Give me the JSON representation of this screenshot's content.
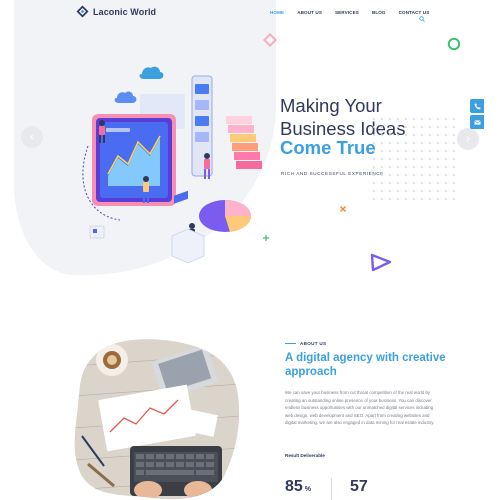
{
  "brand": {
    "name": "Laconic World"
  },
  "nav": {
    "items": [
      {
        "label": "HOME",
        "active": true
      },
      {
        "label": "ABOUT US",
        "active": false
      },
      {
        "label": "SERVICES",
        "active": false
      },
      {
        "label": "BLOG",
        "active": false
      },
      {
        "label": "CONTACT US",
        "active": false
      }
    ]
  },
  "hero": {
    "title_line1": "Making Your",
    "title_line2": "Business Ideas",
    "title_accent": "Come True",
    "subtitle": "RICH AND SUCCESSFUL EXPERIENCE"
  },
  "about": {
    "label": "ABOUT US",
    "title": "A digital agency with creative approach",
    "body": "We can save your business from cut throat competition of the real world by creating an outstanding online presence of your business. You can discover endless business opportunities with our unmatched digital services including web design, web development and SEO. Apart from creating websites and digital marketing, we are also engaged in data mining for real estate industry.",
    "result_label": "Result Deliverable",
    "stats": [
      {
        "value": "85",
        "unit": "%"
      },
      {
        "value": "57",
        "unit": ""
      }
    ]
  },
  "icons": {
    "logo": "diamond-logo-icon",
    "search": "search-icon",
    "prev": "chevron-left-icon",
    "next": "chevron-right-icon",
    "phone": "phone-icon",
    "mail": "mail-icon"
  },
  "colors": {
    "accent": "#3aa0e0",
    "navy": "#2f3a5c",
    "green": "#39c46b",
    "pink": "#f2b2bd",
    "purple": "#7a5cf0",
    "orange": "#f7862f"
  }
}
